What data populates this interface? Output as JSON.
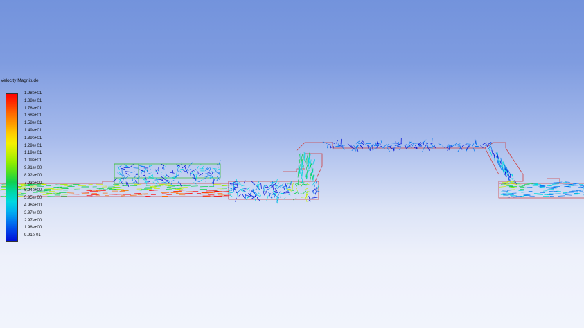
{
  "legend": {
    "title": "Velocity Magnitude",
    "colors": [
      "#ff0000",
      "#ff3300",
      "#ff6a00",
      "#ff9a00",
      "#ffcc00",
      "#f6f000",
      "#c8f000",
      "#90ee00",
      "#50e020",
      "#10d050",
      "#00d8a8",
      "#00d8e0",
      "#00b0f0",
      "#0078f0",
      "#0040e8",
      "#0010d8"
    ],
    "labels": [
      "1.98e+01",
      "1.88e+01",
      "1.78e+01",
      "1.68e+01",
      "1.58e+01",
      "1.49e+01",
      "1.39e+01",
      "1.29e+01",
      "1.19e+01",
      "1.09e+01",
      "9.91e+00",
      "8.92e+00",
      "7.93e+00",
      "6.94e+00",
      "5.95e+00",
      "4.96e+00",
      "3.97e+00",
      "2.97e+00",
      "1.98e+00",
      "9.91e-01"
    ]
  },
  "scene": {
    "outline_color": "#d04040",
    "box_color": "#40c040",
    "vector_colors": [
      "#0010d8",
      "#0078f0",
      "#00d8e0",
      "#10d050",
      "#c8f000",
      "#ffcc00",
      "#ff6a00",
      "#ff0000"
    ]
  }
}
